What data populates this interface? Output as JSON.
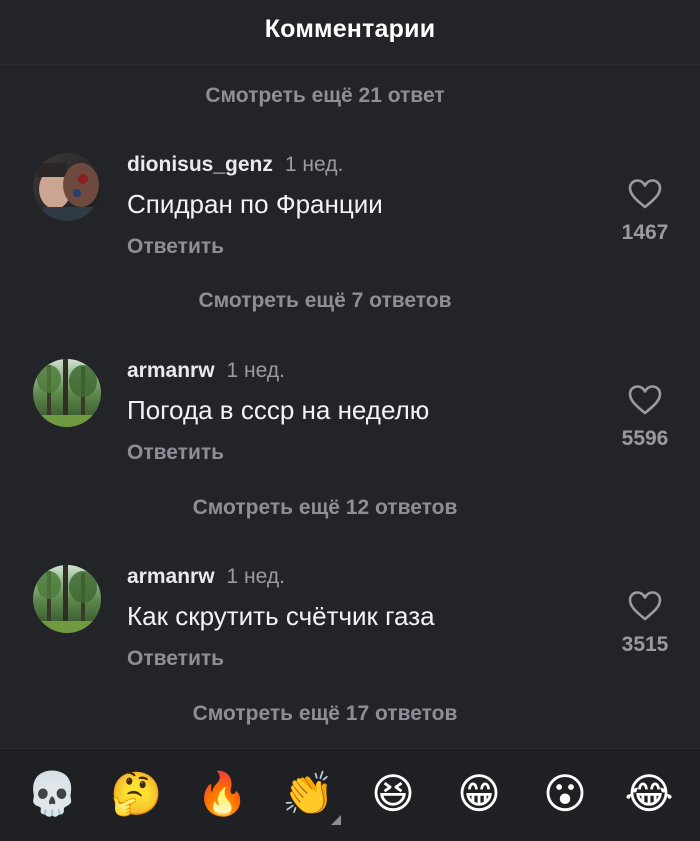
{
  "header": {
    "title": "Комментарии"
  },
  "more_replies": [
    "Смотреть ещё 21 ответ",
    "Смотреть ещё 7 ответов",
    "Смотреть ещё 12 ответов",
    "Смотреть ещё 17 ответов"
  ],
  "comments": [
    {
      "username": "dionisus_genz",
      "time": "1 нед.",
      "text": "Спидран по Франции",
      "reply": "Ответить",
      "likes": "1467",
      "avatar": "face-photo"
    },
    {
      "username": "armanrw",
      "time": "1 нед.",
      "text": "Погода в ссср на неделю",
      "reply": "Ответить",
      "likes": "5596",
      "avatar": "forest-photo"
    },
    {
      "username": "armanrw",
      "time": "1 нед.",
      "text": "Как скрутить счётчик газа",
      "reply": "Ответить",
      "likes": "3515",
      "avatar": "forest-photo"
    }
  ],
  "emoji_bar": [
    {
      "name": "skull-emoji",
      "glyph": "💀"
    },
    {
      "name": "thinking-face-emoji",
      "glyph": "🤔"
    },
    {
      "name": "fire-emoji",
      "glyph": "🔥"
    },
    {
      "name": "clapping-hands-emoji",
      "glyph": "👏"
    },
    {
      "name": "grinning-squinting-face-emoji",
      "glyph": "😆"
    },
    {
      "name": "beaming-face-emoji",
      "glyph": "😁"
    },
    {
      "name": "astonished-face-emoji",
      "glyph": "😮"
    },
    {
      "name": "tears-of-joy-emoji",
      "glyph": "😂"
    }
  ],
  "colors": {
    "background": "#232428",
    "muted_text": "#8e8f96",
    "primary_text": "#f3f3f5",
    "emoji_bar_bg": "#1f2024"
  }
}
